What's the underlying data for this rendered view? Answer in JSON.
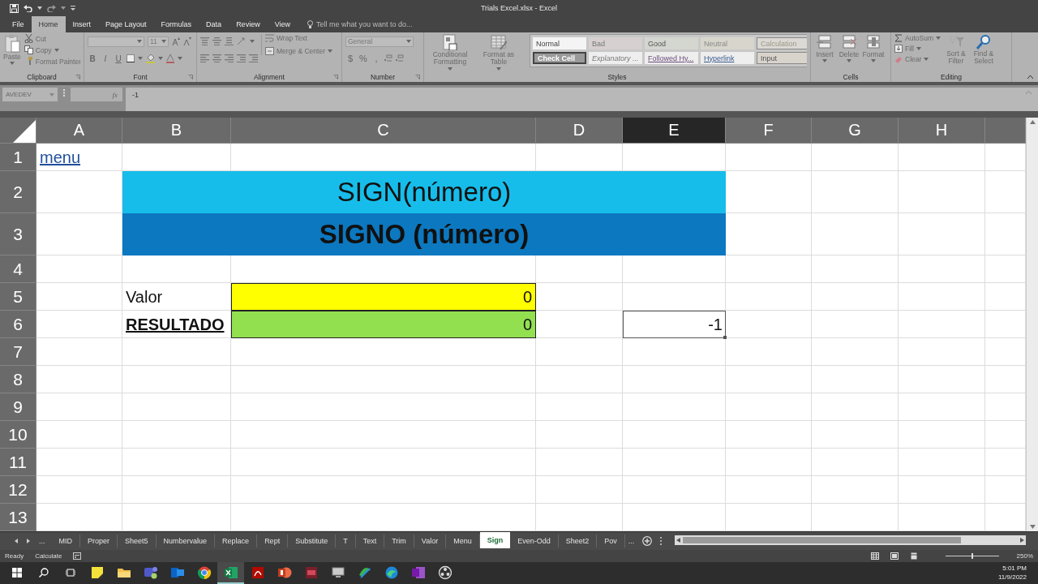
{
  "window": {
    "title": "Trials Excel.xlsx - Excel"
  },
  "ribbon_tabs": [
    {
      "label": "File",
      "selected": false
    },
    {
      "label": "Home",
      "selected": true
    },
    {
      "label": "Insert",
      "selected": false
    },
    {
      "label": "Page Layout",
      "selected": false
    },
    {
      "label": "Formulas",
      "selected": false
    },
    {
      "label": "Data",
      "selected": false
    },
    {
      "label": "Review",
      "selected": false
    },
    {
      "label": "View",
      "selected": false
    }
  ],
  "tell_me": {
    "placeholder": "Tell me what you want to do..."
  },
  "ribbon": {
    "groups": [
      {
        "name": "Clipboard",
        "kind": "clipboard",
        "paste": "Paste",
        "items": [
          "Cut",
          "Copy",
          "Format Painter"
        ]
      },
      {
        "name": "Font",
        "kind": "font",
        "size": "11",
        "keys": [
          "B",
          "I",
          "U"
        ]
      },
      {
        "name": "Alignment",
        "kind": "alignment",
        "items": [
          "Wrap Text",
          "Merge & Center"
        ]
      },
      {
        "name": "Number",
        "kind": "number",
        "format": "General",
        "symbols": [
          "$",
          "%",
          ","
        ]
      },
      {
        "name": "Styles",
        "kind": "styles",
        "buttons": [
          "Conditional Formatting",
          "Format as Table"
        ],
        "gallery": [
          {
            "label": "Normal",
            "kind": "normal"
          },
          {
            "label": "Bad",
            "kind": "bad"
          },
          {
            "label": "Good",
            "kind": "good"
          },
          {
            "label": "Neutral",
            "kind": "neutral"
          },
          {
            "label": "Calculation",
            "kind": "calculation"
          },
          {
            "label": "Check Cell",
            "kind": "check"
          },
          {
            "label": "Explanatory ...",
            "kind": "explanatory"
          },
          {
            "label": "Followed Hy...",
            "kind": "followed"
          },
          {
            "label": "Hyperlink",
            "kind": "hyperlink"
          },
          {
            "label": "Input",
            "kind": "input"
          }
        ]
      },
      {
        "name": "Cells",
        "kind": "cells",
        "buttons": [
          "Insert",
          "Delete",
          "Format"
        ]
      },
      {
        "name": "Editing",
        "kind": "editing",
        "items": [
          "AutoSum",
          "Fill",
          "Clear"
        ],
        "buttons": [
          "Sort & Filter",
          "Find & Select"
        ]
      }
    ]
  },
  "formula_bar": {
    "name_box": "AVEDEV",
    "function_label": "fx",
    "value": "-1"
  },
  "sheet": {
    "columns": [
      {
        "label": "A",
        "selected": false
      },
      {
        "label": "B",
        "selected": false
      },
      {
        "label": "C",
        "selected": false
      },
      {
        "label": "D",
        "selected": false
      },
      {
        "label": "E",
        "selected": true
      },
      {
        "label": "F",
        "selected": false
      },
      {
        "label": "G",
        "selected": false
      },
      {
        "label": "H",
        "selected": false
      }
    ],
    "rows": [
      {
        "header": "1",
        "cells": [
          {
            "text": "menu",
            "kind": "link",
            "bold": false,
            "underline": true,
            "selected": false
          }
        ]
      },
      {
        "header": "2",
        "cells": [
          {
            "kind": "empty"
          },
          {
            "text": "SIGN(número)",
            "kind": "title",
            "bold": false,
            "underline": false,
            "selected": false,
            "color": "#17bdea"
          },
          {
            "kind": "merged"
          },
          {
            "kind": "merged"
          },
          {
            "kind": "merged"
          }
        ]
      },
      {
        "header": "3",
        "cells": [
          {
            "kind": "empty"
          },
          {
            "text": "SIGNO (número)",
            "kind": "title",
            "bold": true,
            "underline": false,
            "selected": false,
            "color": "#0c78c0"
          },
          {
            "kind": "merged"
          },
          {
            "kind": "merged"
          },
          {
            "kind": "merged"
          }
        ]
      },
      {
        "header": "4"
      },
      {
        "header": "5",
        "cells": [
          {
            "kind": "empty"
          },
          {
            "text": "Valor",
            "kind": "label",
            "bold": false,
            "underline": false,
            "selected": false
          },
          {
            "text": "0",
            "kind": "number",
            "bold": false,
            "underline": false,
            "selected": false,
            "color": "#ffff00"
          }
        ]
      },
      {
        "header": "6",
        "cells": [
          {
            "kind": "empty"
          },
          {
            "text": "RESULTADO",
            "kind": "label",
            "bold": true,
            "underline": true,
            "selected": false
          },
          {
            "text": "0",
            "kind": "number",
            "bold": false,
            "underline": false,
            "selected": false,
            "color": "#92e050"
          },
          {
            "kind": "empty"
          },
          {
            "text": "-1",
            "kind": "number",
            "bold": false,
            "underline": false,
            "selected": true
          }
        ]
      },
      {
        "header": "7"
      },
      {
        "header": "8"
      },
      {
        "header": "9"
      },
      {
        "header": "10"
      },
      {
        "header": "11"
      },
      {
        "header": "12"
      },
      {
        "header": "13"
      }
    ]
  },
  "sheet_tabs": {
    "more_left": "...",
    "tabs": [
      {
        "label": "MID",
        "selected": false
      },
      {
        "label": "Proper",
        "selected": false
      },
      {
        "label": "Sheet5",
        "selected": false
      },
      {
        "label": "Numbervalue",
        "selected": false
      },
      {
        "label": "Replace",
        "selected": false
      },
      {
        "label": "Rept",
        "selected": false
      },
      {
        "label": "Substitute",
        "selected": false
      },
      {
        "label": "T",
        "selected": false
      },
      {
        "label": "Text",
        "selected": false
      },
      {
        "label": "Trim",
        "selected": false
      },
      {
        "label": "Valor",
        "selected": false
      },
      {
        "label": "Menu",
        "selected": false
      },
      {
        "label": "Sign",
        "selected": true
      },
      {
        "label": "Even-Odd",
        "selected": false
      },
      {
        "label": "Sheet2",
        "selected": false
      },
      {
        "label": "Pov",
        "selected": false
      }
    ],
    "more_right": "..."
  },
  "status_bar": {
    "mode": "Ready",
    "calculate": "Calculate",
    "zoom_slider": {
      "level": 0.5
    },
    "zoom": "250%"
  },
  "taskbar": {
    "apps": [
      {
        "kind": "note",
        "selected": false
      },
      {
        "kind": "folder",
        "selected": false
      },
      {
        "kind": "chat",
        "selected": false
      },
      {
        "kind": "mail",
        "selected": false
      },
      {
        "kind": "browser",
        "selected": false
      },
      {
        "kind": "sheet",
        "selected": true
      },
      {
        "kind": "pdf",
        "selected": false
      },
      {
        "kind": "slides",
        "selected": false
      },
      {
        "kind": "tile",
        "selected": false
      },
      {
        "kind": "monitor",
        "selected": false
      },
      {
        "kind": "swirl",
        "selected": false
      },
      {
        "kind": "wave",
        "selected": false
      },
      {
        "kind": "notebook",
        "selected": false
      },
      {
        "kind": "aperture",
        "selected": false
      }
    ],
    "time": "5:01 PM",
    "date": "11/9/2022"
  }
}
